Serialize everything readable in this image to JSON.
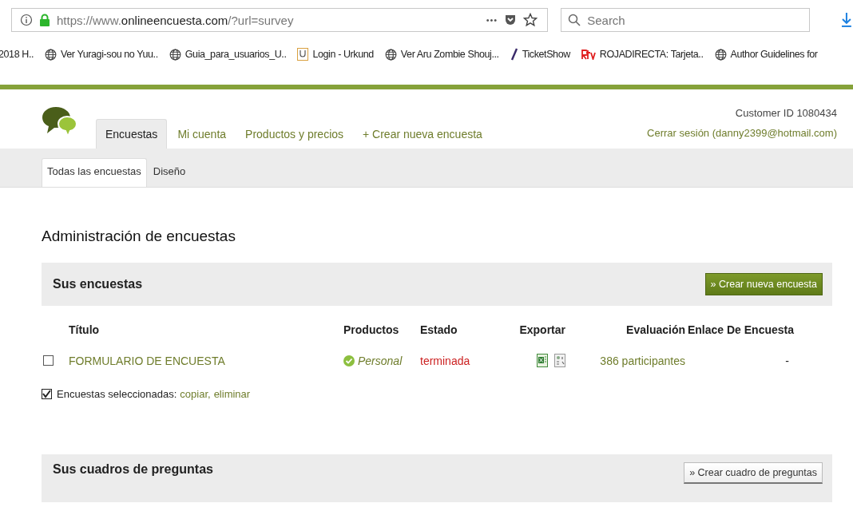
{
  "browser": {
    "url_scheme": "https://www.",
    "url_domain": "onlineencuesta.com",
    "url_path": "/?url=survey",
    "more": "•••",
    "search": {
      "placeholder": "Search"
    },
    "bookmarks": [
      {
        "kind": "none",
        "label": "2018 H.."
      },
      {
        "kind": "globe",
        "label": "Ver Yuragi-sou no Yuu.."
      },
      {
        "kind": "globe",
        "label": "Guia_para_usuarios_U.."
      },
      {
        "kind": "urkund",
        "label": "Login - Urkund"
      },
      {
        "kind": "globe",
        "label": "Ver Aru Zombie Shouj..."
      },
      {
        "kind": "ticket",
        "label": "TicketShow"
      },
      {
        "kind": "rtv",
        "label": "ROJADIRECTA: Tarjeta.."
      },
      {
        "kind": "globe",
        "label": "Author Guidelines for"
      }
    ]
  },
  "header": {
    "tabs": [
      {
        "label": "Encuestas",
        "selected": true
      },
      {
        "label": "Mi cuenta",
        "selected": false
      },
      {
        "label": "Productos y precios",
        "selected": false
      },
      {
        "label": "+ Crear nueva encuesta",
        "selected": false
      }
    ],
    "customer_id": "Customer ID 1080434",
    "logout": "Cerrar sesión (danny2399@hotmail.com)",
    "subtabs": [
      {
        "label": "Todas las encuestas",
        "selected": true
      },
      {
        "label": "Diseño",
        "selected": false
      }
    ]
  },
  "page_title": "Administración de encuestas",
  "surveys": {
    "title": "Sus encuestas",
    "button": "» Crear nueva encuesta",
    "columns": [
      "Título",
      "Productos",
      "Estado",
      "Exportar",
      "Evaluación",
      "Enlace De Encuesta"
    ],
    "rows": [
      {
        "checked": false,
        "title": "FORMULARIO DE ENCUESTA",
        "product": "Personal",
        "product_ok": true,
        "status": {
          "text": "terminada",
          "color": "#cc2222"
        },
        "evaluation": "386 participantes",
        "link": "-"
      }
    ],
    "selection": {
      "checked": true,
      "label": "Encuestas seleccionadas:",
      "actions": [
        "copiar,",
        "eliminar"
      ]
    }
  },
  "question_boxes": {
    "title": "Sus cuadros de preguntas",
    "button": "» Crear cuadro de preguntas"
  }
}
